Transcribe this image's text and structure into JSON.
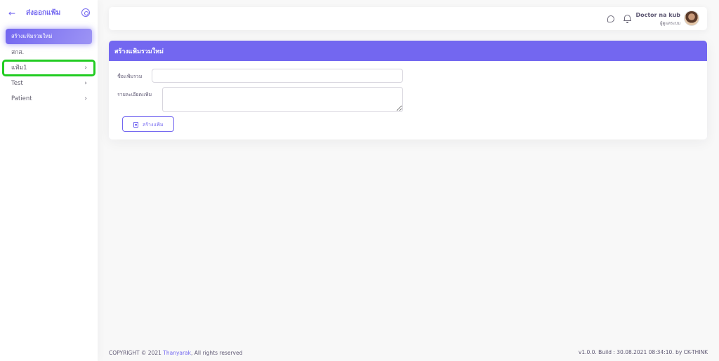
{
  "sidebar": {
    "title": "ส่งออกแฟ้ม",
    "items": [
      {
        "label": "สร้างแฟ้มรวมใหม่",
        "active": true,
        "has_chevron": false
      },
      {
        "label": "สกส.",
        "active": false,
        "has_chevron": false
      },
      {
        "label": "แฟ้ม1",
        "active": false,
        "has_chevron": true,
        "highlighted": true
      },
      {
        "label": "Test",
        "active": false,
        "has_chevron": true
      },
      {
        "label": "Patient",
        "active": false,
        "has_chevron": true
      }
    ],
    "chevron": "›"
  },
  "header": {
    "user_name": "Doctor na kub",
    "user_role": "ผู้ดูแลระบบ",
    "icons": [
      "chat-icon",
      "bell-icon"
    ]
  },
  "card": {
    "title": "สร้างแฟ้มรวมใหม่",
    "name_label": "ชื่อแฟ้มรวม",
    "name_value": "",
    "detail_label": "รายละเอียดแฟ้ม",
    "detail_value": "",
    "create_button": "สร้างแฟ้ม"
  },
  "footer": {
    "copyright_prefix": "COPYRIGHT © 2021 ",
    "brand": "Thanyarak",
    "copyright_suffix": ", All rights reserved",
    "build": "v1.0.0. Build : 30.08.2021 08:34:10. by CK-THINK"
  },
  "colors": {
    "primary": "#7367f0",
    "highlight": "#22cc22",
    "background": "#f8f8f8"
  }
}
